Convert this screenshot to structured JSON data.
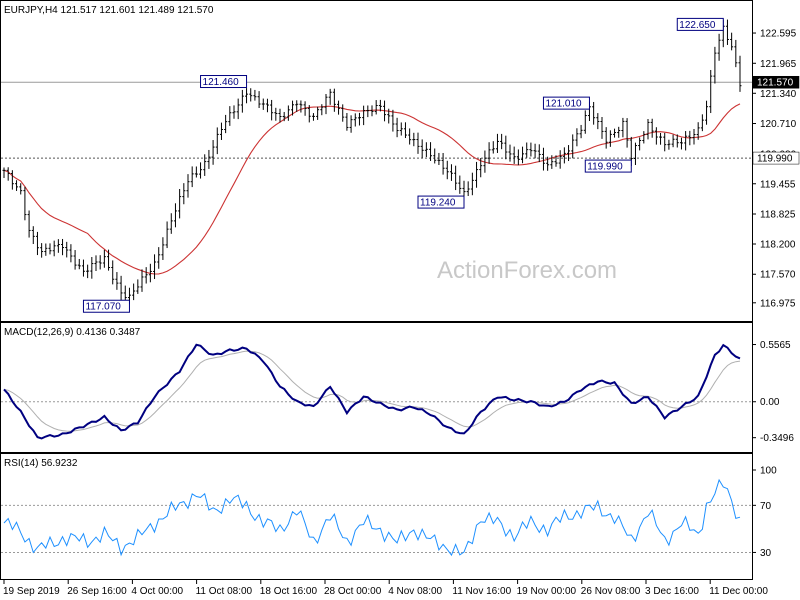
{
  "chart_data": {
    "symbol_line": "EURJPY,H4  121.517 121.601 121.489 121.570",
    "watermark": "ActionForex.com",
    "price_axis": {
      "ylim": [
        116.7,
        122.95
      ],
      "ticks": [
        {
          "label": "122.595",
          "value": 122.595
        },
        {
          "label": "121.965",
          "value": 121.965
        },
        {
          "label": "121.340",
          "value": 121.34
        },
        {
          "label": "120.710",
          "value": 120.71
        },
        {
          "label": "120.080",
          "value": 120.08
        },
        {
          "label": "119.455",
          "value": 119.455
        },
        {
          "label": "118.825",
          "value": 118.825
        },
        {
          "label": "118.200",
          "value": 118.2
        },
        {
          "label": "117.570",
          "value": 117.57
        },
        {
          "label": "116.975",
          "value": 116.975
        }
      ]
    },
    "date_labels": [
      "19 Sep 2019",
      "26 Sep 16:00",
      "4 Oct 00:00",
      "11 Oct 08:00",
      "18 Oct 16:00",
      "28 Oct 00:00",
      "4 Nov 08:00",
      "11 Nov 16:00",
      "19 Nov 00:00",
      "26 Nov 08:00",
      "3 Dec 16:00",
      "11 Dec 00:00"
    ],
    "horizontal_lines": [
      {
        "label": "121.570",
        "value": 121.57,
        "color": "#9a9a9a",
        "style": "solid",
        "tag_bg": "#000000",
        "tag_fg": "#ffffff"
      },
      {
        "label": "119.990",
        "value": 119.99,
        "color": "#555555",
        "style": "dotted",
        "tag_bg": "#ffffff",
        "tag_fg": "#000000"
      }
    ],
    "annotations": [
      {
        "label": "122.650",
        "date_index": 172,
        "value": 122.65
      },
      {
        "label": "121.460",
        "date_index": 58,
        "value": 121.46
      },
      {
        "label": "121.010",
        "date_index": 140,
        "value": 121.01
      },
      {
        "label": "119.990",
        "date_index": 150,
        "value": 119.99
      },
      {
        "label": "119.240",
        "date_index": 110,
        "value": 119.24
      },
      {
        "label": "117.070",
        "date_index": 30,
        "value": 117.07
      }
    ],
    "price_anchors": [
      [
        0,
        119.7
      ],
      [
        4,
        119.3
      ],
      [
        6,
        118.5
      ],
      [
        9,
        118.0
      ],
      [
        14,
        118.2
      ],
      [
        19,
        117.6
      ],
      [
        24,
        117.9
      ],
      [
        28,
        117.2
      ],
      [
        30,
        117.07
      ],
      [
        36,
        117.8
      ],
      [
        40,
        118.7
      ],
      [
        44,
        119.5
      ],
      [
        48,
        119.9
      ],
      [
        52,
        120.6
      ],
      [
        56,
        121.1
      ],
      [
        58,
        121.4
      ],
      [
        62,
        121.1
      ],
      [
        66,
        120.8
      ],
      [
        70,
        121.2
      ],
      [
        74,
        120.8
      ],
      [
        78,
        121.35
      ],
      [
        82,
        120.7
      ],
      [
        86,
        120.9
      ],
      [
        90,
        121.1
      ],
      [
        94,
        120.6
      ],
      [
        98,
        120.3
      ],
      [
        102,
        120.1
      ],
      [
        106,
        119.7
      ],
      [
        110,
        119.24
      ],
      [
        114,
        119.9
      ],
      [
        118,
        120.3
      ],
      [
        122,
        120.0
      ],
      [
        126,
        120.2
      ],
      [
        130,
        119.8
      ],
      [
        134,
        120.1
      ],
      [
        138,
        120.6
      ],
      [
        140,
        121.01
      ],
      [
        144,
        120.4
      ],
      [
        148,
        120.7
      ],
      [
        150,
        119.99
      ],
      [
        154,
        120.7
      ],
      [
        158,
        120.3
      ],
      [
        162,
        120.3
      ],
      [
        166,
        120.6
      ],
      [
        168,
        121.1
      ],
      [
        170,
        122.2
      ],
      [
        172,
        122.65
      ],
      [
        174,
        122.3
      ],
      [
        176,
        121.57
      ]
    ],
    "moving_average": {
      "name": "",
      "color": "#cc3333"
    },
    "macd": {
      "label": "MACD(12,26,9) 0.4136 0.3487",
      "ylim": [
        -0.45,
        0.62
      ],
      "ticks": [
        {
          "label": "0.5565",
          "value": 0.5565
        },
        {
          "label": "0.00",
          "value": 0.0
        },
        {
          "label": "-0.3496",
          "value": -0.3496
        }
      ],
      "main_color": "#000080",
      "signal_color": "#b0b0b0",
      "anchors": [
        [
          0,
          0.12
        ],
        [
          4,
          -0.1
        ],
        [
          8,
          -0.35
        ],
        [
          14,
          -0.32
        ],
        [
          20,
          -0.22
        ],
        [
          24,
          -0.15
        ],
        [
          28,
          -0.28
        ],
        [
          32,
          -0.2
        ],
        [
          36,
          0.05
        ],
        [
          42,
          0.3
        ],
        [
          46,
          0.56
        ],
        [
          50,
          0.45
        ],
        [
          54,
          0.5
        ],
        [
          58,
          0.52
        ],
        [
          62,
          0.4
        ],
        [
          66,
          0.15
        ],
        [
          70,
          0.0
        ],
        [
          74,
          -0.05
        ],
        [
          78,
          0.15
        ],
        [
          82,
          -0.1
        ],
        [
          86,
          0.05
        ],
        [
          90,
          -0.02
        ],
        [
          94,
          -0.08
        ],
        [
          98,
          -0.05
        ],
        [
          102,
          -0.12
        ],
        [
          106,
          -0.25
        ],
        [
          110,
          -0.32
        ],
        [
          114,
          -0.1
        ],
        [
          118,
          0.05
        ],
        [
          122,
          0.02
        ],
        [
          126,
          0.0
        ],
        [
          130,
          -0.05
        ],
        [
          134,
          0.0
        ],
        [
          138,
          0.12
        ],
        [
          142,
          0.2
        ],
        [
          146,
          0.18
        ],
        [
          150,
          -0.02
        ],
        [
          154,
          0.05
        ],
        [
          158,
          -0.15
        ],
        [
          162,
          -0.05
        ],
        [
          166,
          0.05
        ],
        [
          168,
          0.25
        ],
        [
          170,
          0.45
        ],
        [
          172,
          0.55
        ],
        [
          174,
          0.48
        ],
        [
          176,
          0.41
        ]
      ]
    },
    "rsi": {
      "label": "RSI(14) 56.9232",
      "ylim": [
        10,
        100
      ],
      "ticks": [
        {
          "label": "100",
          "value": 100
        },
        {
          "label": "70",
          "value": 70
        },
        {
          "label": "30",
          "value": 30
        }
      ],
      "color": "#1e90ff",
      "anchors": [
        [
          0,
          55
        ],
        [
          4,
          48
        ],
        [
          8,
          32
        ],
        [
          14,
          42
        ],
        [
          20,
          40
        ],
        [
          24,
          45
        ],
        [
          28,
          35
        ],
        [
          32,
          42
        ],
        [
          36,
          55
        ],
        [
          42,
          70
        ],
        [
          46,
          80
        ],
        [
          50,
          65
        ],
        [
          54,
          75
        ],
        [
          58,
          70
        ],
        [
          62,
          55
        ],
        [
          66,
          50
        ],
        [
          70,
          65
        ],
        [
          74,
          40
        ],
        [
          78,
          60
        ],
        [
          82,
          40
        ],
        [
          86,
          55
        ],
        [
          90,
          50
        ],
        [
          94,
          38
        ],
        [
          98,
          50
        ],
        [
          102,
          40
        ],
        [
          106,
          35
        ],
        [
          110,
          27
        ],
        [
          114,
          60
        ],
        [
          118,
          55
        ],
        [
          122,
          45
        ],
        [
          126,
          55
        ],
        [
          130,
          50
        ],
        [
          134,
          60
        ],
        [
          138,
          65
        ],
        [
          142,
          68
        ],
        [
          146,
          60
        ],
        [
          150,
          40
        ],
        [
          154,
          65
        ],
        [
          158,
          40
        ],
        [
          162,
          55
        ],
        [
          166,
          45
        ],
        [
          168,
          70
        ],
        [
          170,
          80
        ],
        [
          172,
          88
        ],
        [
          174,
          75
        ],
        [
          176,
          57
        ]
      ]
    }
  }
}
